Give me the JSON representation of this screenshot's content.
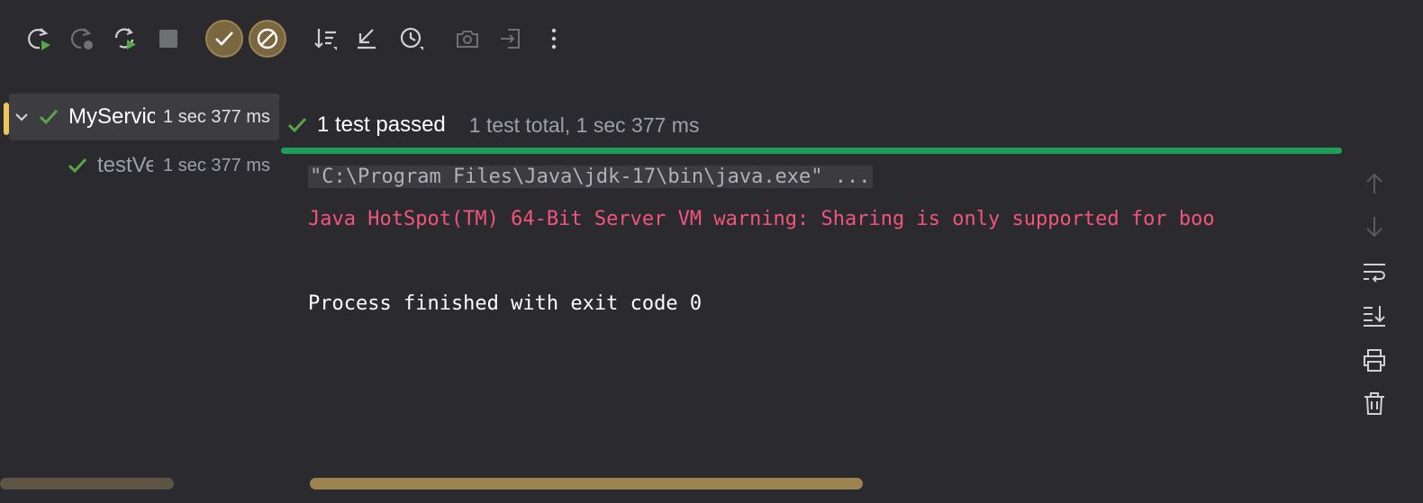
{
  "toolbar": {
    "buttons": [
      {
        "name": "rerun-icon",
        "title": "Rerun"
      },
      {
        "name": "rerun-failed-icon",
        "title": "Rerun Failed Tests"
      },
      {
        "name": "toggle-auto-test-icon",
        "title": "Toggle auto-test"
      },
      {
        "name": "stop-icon",
        "title": "Stop"
      },
      {
        "name": "show-passed-icon",
        "title": "Show Passed"
      },
      {
        "name": "show-ignored-icon",
        "title": "Show Ignored"
      },
      {
        "name": "sort-icon",
        "title": "Sort"
      },
      {
        "name": "collapse-icon",
        "title": "Collapse"
      },
      {
        "name": "history-icon",
        "title": "Test History"
      },
      {
        "name": "camera-icon",
        "title": "Screenshot"
      },
      {
        "name": "import-icon",
        "title": "Import Tests"
      },
      {
        "name": "more-icon",
        "title": "More"
      }
    ]
  },
  "tree": {
    "items": [
      {
        "name": "MyServic",
        "time": "1 sec 377 ms",
        "status": "passed"
      },
      {
        "name": "testVe",
        "time": "1 sec 377 ms",
        "status": "passed"
      }
    ]
  },
  "status": {
    "title": "1 test passed",
    "summary": "1 test total, 1 sec 377 ms",
    "progress": 1.0
  },
  "console": {
    "lines": [
      {
        "text": "\"C:\\Program Files\\Java\\jdk-17\\bin\\java.exe\" ...",
        "kind": "command"
      },
      {
        "text": "Java HotSpot(TM) 64-Bit Server VM warning: Sharing is only supported for boo",
        "kind": "error"
      },
      {
        "text": "",
        "kind": "normal"
      },
      {
        "text": "Process finished with exit code 0",
        "kind": "normal"
      }
    ]
  },
  "side_actions": [
    {
      "name": "up-arrow-icon"
    },
    {
      "name": "down-arrow-icon"
    },
    {
      "name": "soft-wrap-icon"
    },
    {
      "name": "scroll-to-end-icon"
    },
    {
      "name": "print-icon"
    },
    {
      "name": "trash-icon"
    }
  ],
  "colors": {
    "background": "#2b2a2e",
    "passed": "#1f9e5a",
    "error_text": "#f0557b",
    "toggle_active": "#7a6740",
    "scrollbar": "#9c8450"
  }
}
